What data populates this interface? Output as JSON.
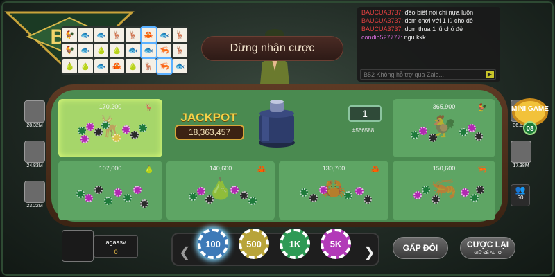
{
  "brand": {
    "logo_text": "B52"
  },
  "status_banner": "Dừng nhận cược",
  "chat": {
    "messages": [
      {
        "user": "BAUCUA3737:",
        "text": "đéo biết nói chi nựa luôn"
      },
      {
        "user": "BAUCUA3737:",
        "text": "dcm chơi với 1 lũ chó đẻ"
      },
      {
        "user": "BAUCUA3737:",
        "text": "dcm thua 1 lũ chó đẻ"
      },
      {
        "user": "condib527777:",
        "text": "ngu kkk"
      }
    ],
    "input_placeholder": "B52 Không hỗ trợ qua Zalo..."
  },
  "jackpot": {
    "label": "JACKPOT",
    "value": "18,363,457"
  },
  "round": {
    "number": "1",
    "id": "#566588"
  },
  "bet_cells": [
    {
      "amount": "170,200",
      "icon": "deer-icon",
      "glyph": "🦌",
      "selected": true
    },
    {
      "amount": "365,900",
      "icon": "rooster-icon",
      "glyph": "🐓",
      "selected": false
    },
    {
      "amount": "107,600",
      "icon": "gourd-icon",
      "glyph": "🍐",
      "selected": false
    },
    {
      "amount": "140,600",
      "icon": "crab-icon",
      "glyph": "🦀",
      "selected": false
    },
    {
      "amount": "130,700",
      "icon": "crab-icon",
      "glyph": "🦀",
      "selected": false
    },
    {
      "amount": "150,600",
      "icon": "shrimp-icon",
      "glyph": "🦐",
      "selected": false
    }
  ],
  "left_players": [
    {
      "balance": "28.32M"
    },
    {
      "balance": "24.83M"
    },
    {
      "balance": "23.22M"
    }
  ],
  "right_players": [
    {
      "balance": "36.61M"
    },
    {
      "balance": "17.38M"
    }
  ],
  "mini_game": {
    "label": "MINI GAME",
    "count": "08"
  },
  "online_count": "50",
  "player": {
    "name": "agaasv",
    "money": "0"
  },
  "chips": [
    {
      "label": "100",
      "color": "#3d7ab8"
    },
    {
      "label": "500",
      "color": "#b8a43a"
    },
    {
      "label": "1K",
      "color": "#2e9a55"
    },
    {
      "label": "5K",
      "color": "#b23ab8"
    }
  ],
  "buttons": {
    "double": "GẤP ĐÔI",
    "rebet": "CƯỢC LẠI",
    "rebet_sub": "GIỮ ĐỂ AUTO"
  }
}
